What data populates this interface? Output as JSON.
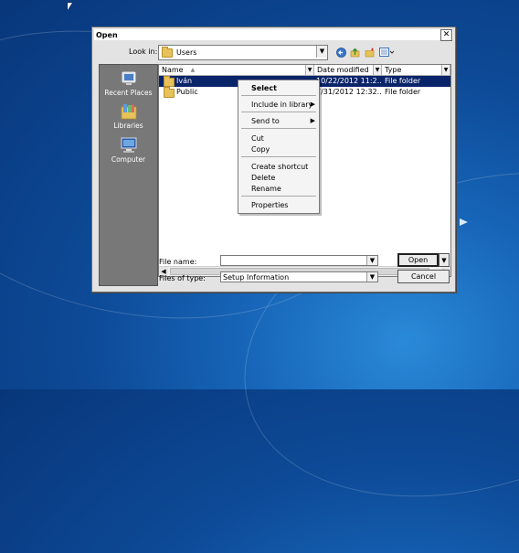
{
  "dialog": {
    "title": "Open",
    "close_glyph": "✕",
    "look_in_label": "Look in:",
    "look_in_value": "Users",
    "file_name_label": "File name:",
    "file_name_value": "",
    "files_of_type_label": "Files of type:",
    "files_of_type_value": "Setup Information",
    "open_button": "Open",
    "cancel_button": "Cancel"
  },
  "toolbar": {
    "icons": [
      "back-icon",
      "up-folder-icon",
      "new-folder-icon",
      "view-menu-icon"
    ]
  },
  "places": [
    {
      "label": "Recent Places",
      "icon": "recent-places-icon"
    },
    {
      "label": "Libraries",
      "icon": "libraries-icon"
    },
    {
      "label": "Computer",
      "icon": "computer-icon"
    }
  ],
  "columns": {
    "name": "Name",
    "date": "Date modified",
    "type": "Type"
  },
  "files": [
    {
      "name": "Iván",
      "date": "10/22/2012 11:2...",
      "type": "File folder",
      "selected": true
    },
    {
      "name": "Public",
      "date": "7/31/2012 12:32...",
      "type": "File folder",
      "selected": false
    }
  ],
  "context_menu": {
    "items": [
      "Select",
      "Include in library",
      "Send to",
      "Cut",
      "Copy",
      "Create shortcut",
      "Delete",
      "Rename",
      "Properties"
    ]
  },
  "colors": {
    "selection": "#0a246a",
    "desktop": "#0d4a97",
    "dialog": "#e3e3e3",
    "places_panel": "#787878"
  }
}
